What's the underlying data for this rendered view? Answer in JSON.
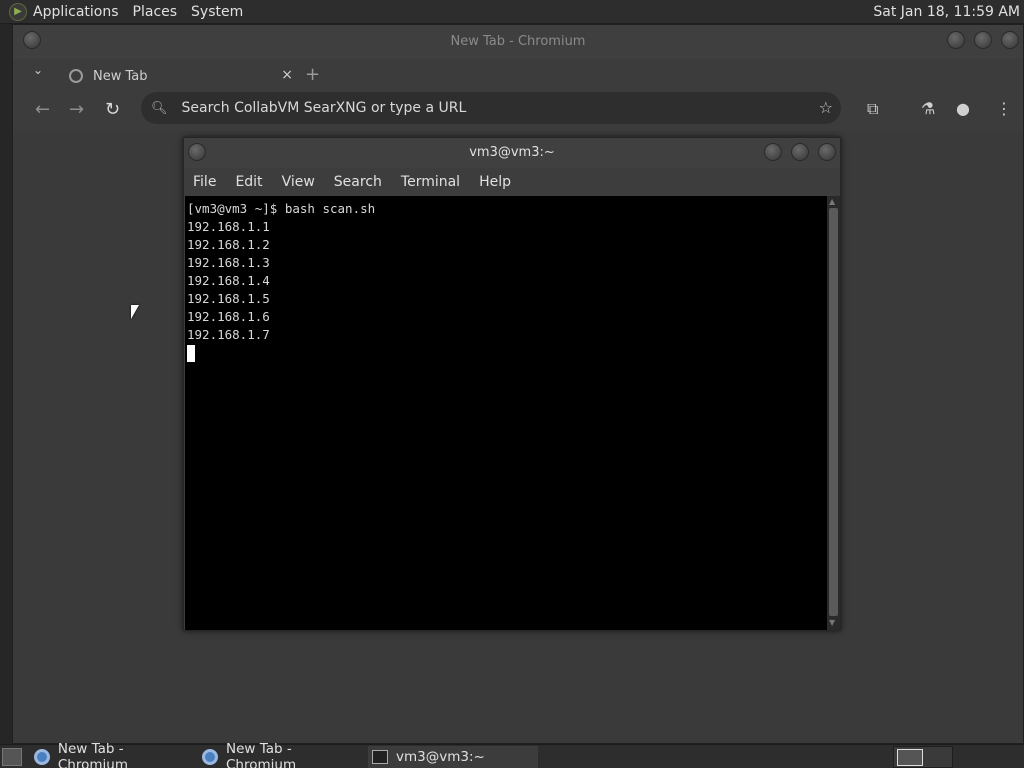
{
  "top_panel": {
    "menus": [
      "Applications",
      "Places",
      "System"
    ],
    "clock": "Sat Jan 18, 11:59 AM"
  },
  "chromium": {
    "window_title": "New Tab - Chromium",
    "tab_label": "New Tab",
    "tab_close": "×",
    "new_tab": "+",
    "omnibox_placeholder": "Search CollabVM SearXNG or type a URL"
  },
  "terminal": {
    "window_title": "vm3@vm3:~",
    "menus": [
      "File",
      "Edit",
      "View",
      "Search",
      "Terminal",
      "Help"
    ],
    "lines": [
      "[vm3@vm3 ~]$ bash scan.sh",
      "192.168.1.1",
      "192.168.1.2",
      "192.168.1.3",
      "192.168.1.4",
      "192.168.1.5",
      "192.168.1.6",
      "192.168.1.7"
    ]
  },
  "taskbar": {
    "tasks": [
      {
        "label": "New Tab - Chromium",
        "icon": "chromium-icon"
      },
      {
        "label": "New Tab - Chromium",
        "icon": "chromium-icon"
      },
      {
        "label": "vm3@vm3:~",
        "icon": "terminal-icon"
      }
    ]
  }
}
